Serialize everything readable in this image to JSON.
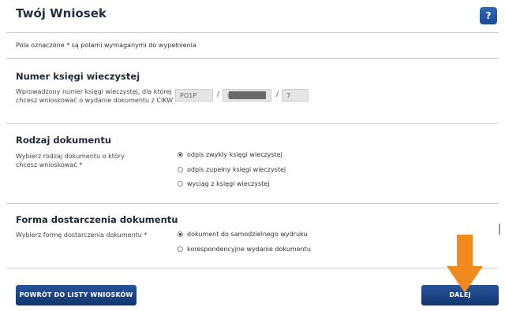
{
  "header": {
    "title": "Twój Wniosek",
    "help_label": "?"
  },
  "note": "Pola oznaczone * są polami wymaganymi do wypełnienia",
  "section1": {
    "heading": "Numer księgi wieczystej",
    "description": "Wprowadzony numer księgi wieczystej, dla której chcesz wnioskować o wydanie dokumentu z CIKW",
    "court_code": "PO1P",
    "number_prefix": "00",
    "check_digit": "7",
    "separator": "/"
  },
  "section2": {
    "heading": "Rodzaj dokumentu",
    "description": "Wybierz rodzaj dokumentu o który chcesz wnioskować *",
    "options": [
      "odpis zwykły księgi wieczystej",
      "odpis zupełny księgi wieczystej",
      "wyciąg z księgi wieczystej"
    ],
    "selected_index": 0
  },
  "section3": {
    "heading": "Forma dostarczenia dokumentu",
    "description": "Wybierz formę dostarczenia dokumentu *",
    "options": [
      "dokument do samodzielnego wydruku",
      "korespondencyjne wydanie dokumentu"
    ],
    "selected_index": 0
  },
  "buttons": {
    "back": "POWRÓT DO LISTY WNIOSKÓW",
    "next": "DALEJ"
  },
  "colors": {
    "button": "#1b4486",
    "arrow": "#f08a1c",
    "help": "#2a5fae"
  },
  "icons": {
    "arrow": "down-arrow-icon"
  }
}
